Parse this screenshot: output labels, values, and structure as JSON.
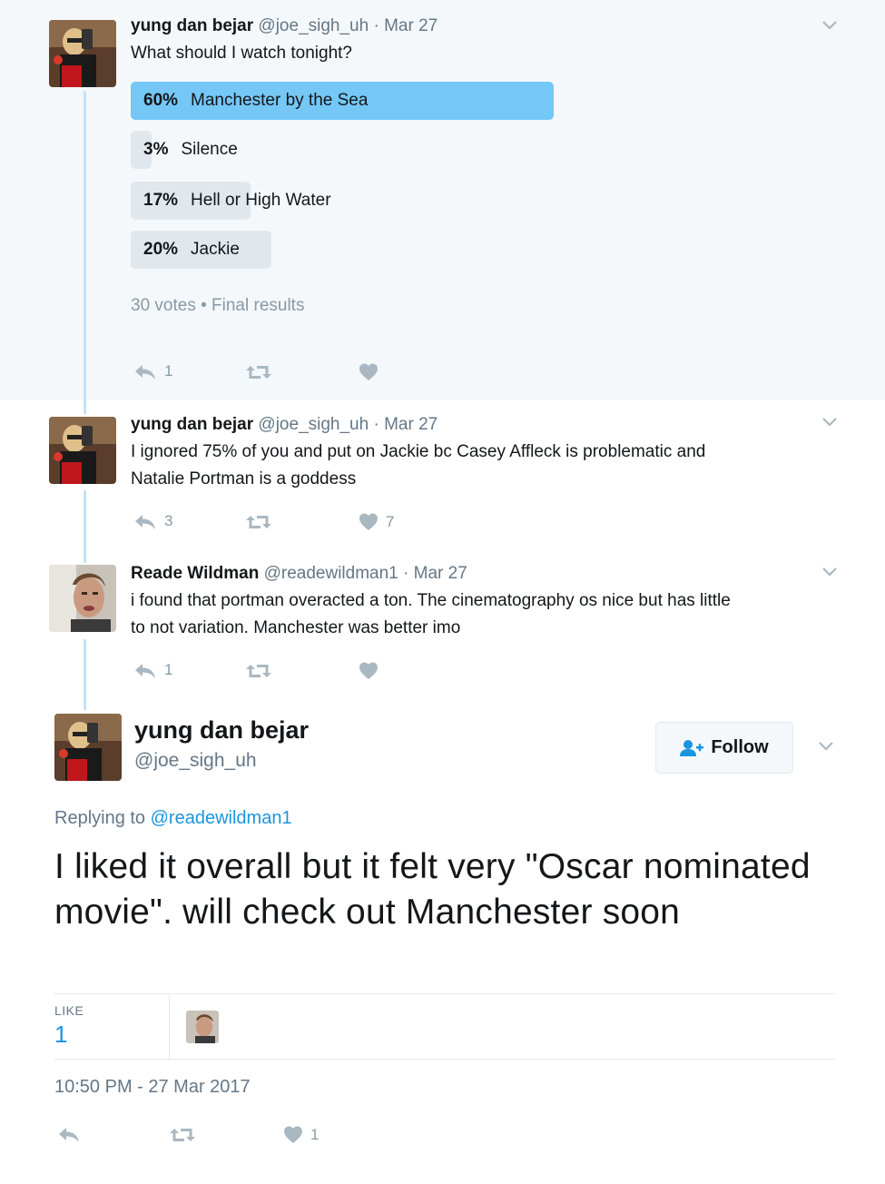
{
  "colors": {
    "accent": "#1b95e0",
    "poll_winner": "#75c7f6",
    "poll_bar": "#e1e8ed",
    "thread_line": "#c4e2f7",
    "muted": "#8899a6"
  },
  "tweets": [
    {
      "name": "yung dan bejar",
      "handle": "@joe_sigh_uh",
      "date": "Mar 27",
      "text": "What should I watch tonight?",
      "poll": {
        "options": [
          {
            "pct": "60%",
            "label": "Manchester by the Sea",
            "value": 60
          },
          {
            "pct": "3%",
            "label": "Silence",
            "value": 3
          },
          {
            "pct": "17%",
            "label": "Hell or High Water",
            "value": 17
          },
          {
            "pct": "20%",
            "label": "Jackie",
            "value": 20
          }
        ],
        "footer": "30 votes • Final results"
      },
      "replies": "1",
      "retweets": "",
      "likes": ""
    },
    {
      "name": "yung dan bejar",
      "handle": "@joe_sigh_uh",
      "date": "Mar 27",
      "text_line1": "I ignored 75% of you and put on Jackie bc Casey Affleck is problematic and",
      "text_line2": "Natalie Portman is a goddess",
      "replies": "3",
      "retweets": "",
      "likes": "7"
    },
    {
      "name": "Reade Wildman",
      "handle": "@readewildman1",
      "date": "Mar 27",
      "text_line1": "i found that portman overacted a ton. The cinematography os nice but has little",
      "text_line2": "to not variation. Manchester was better imo",
      "replies": "1",
      "retweets": "",
      "likes": ""
    }
  ],
  "main_tweet": {
    "name": "yung dan bejar",
    "handle": "@joe_sigh_uh",
    "follow_label": "Follow",
    "replying_prefix": "Replying to",
    "replying_to": "@readewildman1",
    "text": "I liked it overall but it felt very \"Oscar nominated movie\". will check out Manchester soon",
    "like_label": "LIKE",
    "like_count": "1",
    "timestamp": "10:50 PM - 27 Mar 2017",
    "replies": "",
    "retweets": "",
    "likes": "1"
  },
  "separator_dot": "·"
}
